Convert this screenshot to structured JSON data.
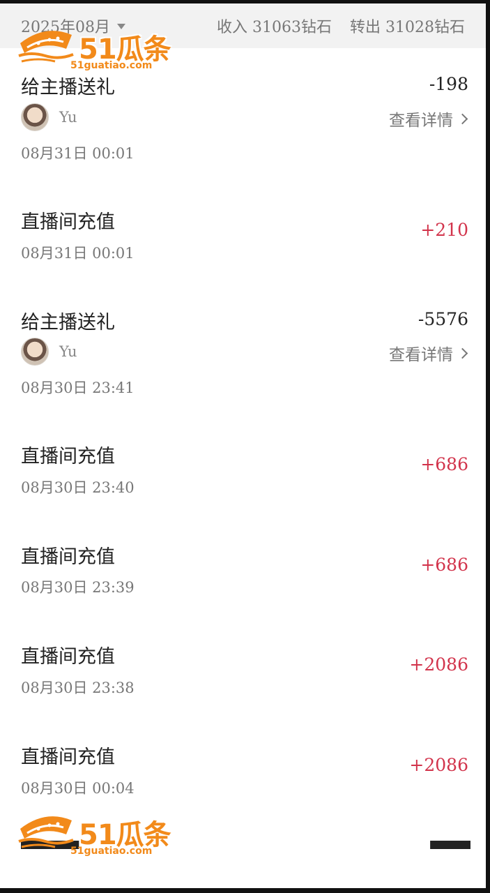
{
  "header": {
    "month": "2025年08月",
    "income": "收入 31063钻石",
    "transfer_out": "转出 31028钻石"
  },
  "transactions": [
    {
      "title": "给主播送礼",
      "amount": "-198",
      "anchor": "Yu",
      "detail": "查看详情",
      "date": "08月31日 00:01"
    },
    {
      "title": "直播间充值",
      "amount": "+210",
      "date": "08月31日 00:01"
    },
    {
      "title": "给主播送礼",
      "amount": "-5576",
      "anchor": "Yu",
      "detail": "查看详情",
      "date": "08月30日 23:41"
    },
    {
      "title": "直播间充值",
      "amount": "+686",
      "date": "08月30日 23:40"
    },
    {
      "title": "直播间充值",
      "amount": "+686",
      "date": "08月30日 23:39"
    },
    {
      "title": "直播间充值",
      "amount": "+2086",
      "date": "08月30日 23:38"
    },
    {
      "title": "直播间充值",
      "amount": "+2086",
      "date": "08月30日 00:04"
    }
  ],
  "watermark": {
    "brand": "51瓜条",
    "domain": "51guatiao.com"
  },
  "colors": {
    "positive": "#d2334b",
    "negative": "#222222",
    "watermark": "#f28a1a",
    "header_bg": "#f2f2f2"
  },
  "icons": [
    "caret-down-icon",
    "chevron-right-icon",
    "avatar"
  ]
}
